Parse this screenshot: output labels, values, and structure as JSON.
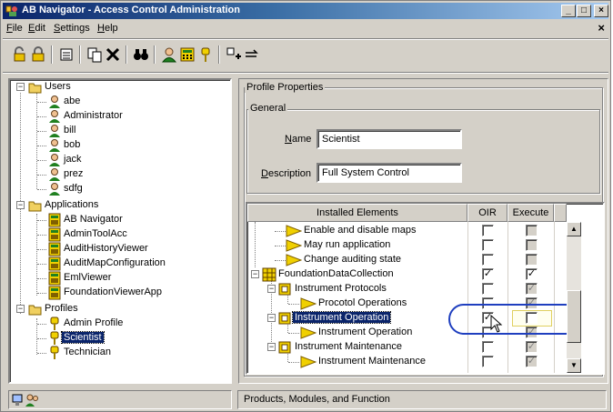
{
  "window": {
    "title": "AB Navigator - Access Control Administration",
    "buttons": [
      "_",
      "□",
      "×"
    ]
  },
  "menu": {
    "items": [
      {
        "label": "File"
      },
      {
        "label": "Edit"
      },
      {
        "label": "Settings"
      },
      {
        "label": "Help"
      }
    ],
    "mdi_close": "×"
  },
  "toolbar": {
    "icons": [
      "open-lock-icon",
      "lock-icon",
      "list-icon",
      "copy-icon",
      "delete-icon",
      "binoculars-icon",
      "user-icon",
      "calculator-icon",
      "key-icon",
      "add-node-icon",
      "link-icon"
    ]
  },
  "tree": {
    "users_label": "Users",
    "users": [
      "abe",
      "Administrator",
      "bill",
      "bob",
      "jack",
      "prez",
      "sdfg"
    ],
    "applications_label": "Applications",
    "applications": [
      "AB Navigator",
      "AdminToolAcc",
      "AuditHistoryViewer",
      "AuditMapConfiguration",
      "EmlViewer",
      "FoundationViewerApp"
    ],
    "profiles_label": "Profiles",
    "profiles": [
      "Admin Profile",
      "Scientist",
      "Technician"
    ],
    "selected": "Scientist"
  },
  "profile": {
    "group_title": "Profile Properties",
    "general_title": "General",
    "name_label": "Name",
    "name_value": "Scientist",
    "description_label": "Description",
    "description_value": "Full System Control"
  },
  "grid": {
    "columns": [
      "Installed Elements",
      "OIR",
      "Execute"
    ],
    "rows": [
      {
        "label": "Enable and disable maps",
        "oir": false,
        "execute": false,
        "exec_disabled": true
      },
      {
        "label": "May run application",
        "oir": false,
        "execute": false,
        "exec_disabled": true
      },
      {
        "label": "Change auditing state",
        "oir": false,
        "execute": false,
        "exec_disabled": true
      },
      {
        "label": "FoundationDataCollection",
        "oir": true,
        "execute": true,
        "exec_disabled": false
      },
      {
        "label": "Instrument Protocols",
        "oir": false,
        "execute": true,
        "exec_disabled": true
      },
      {
        "label": "Procotol Operations",
        "oir": false,
        "execute": true,
        "exec_disabled": true
      },
      {
        "label": "Instrument Operation",
        "oir": true,
        "execute": false,
        "exec_disabled": false
      },
      {
        "label": "Instrument Operation",
        "oir": false,
        "execute": true,
        "exec_disabled": true
      },
      {
        "label": "Instrument Maintenance",
        "oir": false,
        "execute": true,
        "exec_disabled": true
      },
      {
        "label": "Instrument Maintenance",
        "oir": false,
        "execute": true,
        "exec_disabled": true
      }
    ],
    "checkmark": "✓"
  },
  "status": {
    "right_text": "Products, Modules, and Function"
  },
  "colors": {
    "selection": "#0a246a",
    "highlight_oval": "#1f3fbf",
    "face": "#d4d0c8"
  }
}
